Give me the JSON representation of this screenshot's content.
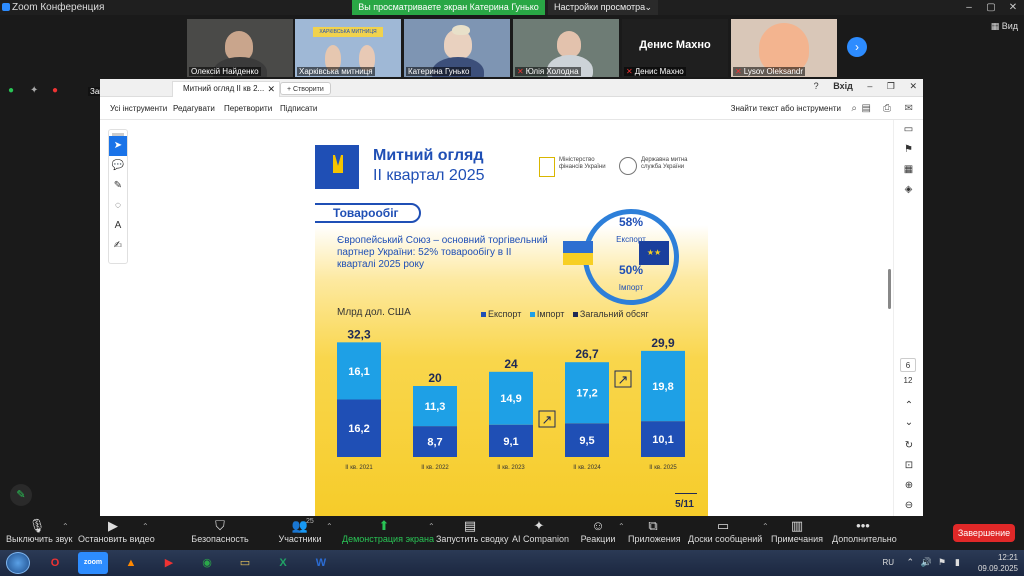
{
  "window": {
    "title": "Zoom Конференция",
    "banner": "Вы просматриваете экран Катерина Гунько",
    "view_options": "Настройки просмотра",
    "view_label": "Вид"
  },
  "participants": [
    {
      "name": "Олексій Найденко",
      "muted": false,
      "video": true
    },
    {
      "name": "Харківська митниця",
      "muted": false,
      "video": true
    },
    {
      "name": "Катерина Гунько",
      "muted": false,
      "video": true
    },
    {
      "name": "Юлія Холодна",
      "muted": true,
      "video": true
    },
    {
      "name": "Денис Махно",
      "muted": true,
      "video": false,
      "big_name": "Денис Махно"
    },
    {
      "name": "Lysov Oleksandr",
      "muted": true,
      "video": true
    }
  ],
  "recording": {
    "label": "Запись..."
  },
  "acrobat": {
    "tab_title": "Митний огляд II кв 2...",
    "new_tab": "Створити",
    "sign_in": "Вхід",
    "menu": [
      "Усі інструменти",
      "Редагувати",
      "Перетворити",
      "Підписати"
    ],
    "find_tools": "Знайти текст або інструменти",
    "page_current": "6",
    "page_total": "12"
  },
  "document": {
    "title_line1": "Митний огляд",
    "title_line2": "ІІ квартал 2025",
    "minfin": "Міністерство фінансів України",
    "dms": "Державна митна служба України",
    "section": "Товарообіг",
    "lead": "Європейський Союз – основний торгівельний партнер України: 52% товарообігу в ІІ кварталі 2025 року",
    "export_pct": "58%",
    "export_label": "Експорт",
    "import_pct": "50%",
    "import_label": "Імпорт",
    "unit": "Млрд дол. США",
    "legend": [
      "Експорт",
      "Імпорт",
      "Загальний обсяг"
    ],
    "page_no": "5/11"
  },
  "chart_data": {
    "type": "bar",
    "categories": [
      "ІІ кв. 2021",
      "ІІ кв. 2022",
      "ІІ кв. 2023",
      "ІІ кв. 2024",
      "ІІ кв. 2025"
    ],
    "series": [
      {
        "name": "Експорт",
        "values": [
          16.2,
          8.7,
          9.1,
          9.5,
          10.1
        ],
        "color": "#1f4fb5"
      },
      {
        "name": "Імпорт",
        "values": [
          16.1,
          11.3,
          14.9,
          17.2,
          19.8
        ],
        "color": "#1ea0e6"
      }
    ],
    "totals": [
      32.3,
      20,
      24,
      26.7,
      29.9
    ],
    "total_labels": [
      "32,3",
      "20",
      "24",
      "26,7",
      "29,9"
    ],
    "export_labels": [
      "16,2",
      "8,7",
      "9,1",
      "9,5",
      "10,1"
    ],
    "import_labels": [
      "16,1",
      "11,3",
      "14,9",
      "17,2",
      "19,8"
    ],
    "ylim": [
      0,
      35
    ],
    "grid": false
  },
  "toolbar": {
    "items": [
      "Выключить звук",
      "Остановить видео",
      "Безопасность",
      "Участники",
      "Демонстрация экрана",
      "Запустить сводку",
      "AI Companion",
      "Реакции",
      "Приложения",
      "Доски сообщений",
      "Примечания",
      "Дополнительно"
    ],
    "participants_count": "25",
    "end": "Завершение"
  },
  "taskbar": {
    "lang": "RU",
    "time": "12:21",
    "date": "09.09.2025"
  }
}
